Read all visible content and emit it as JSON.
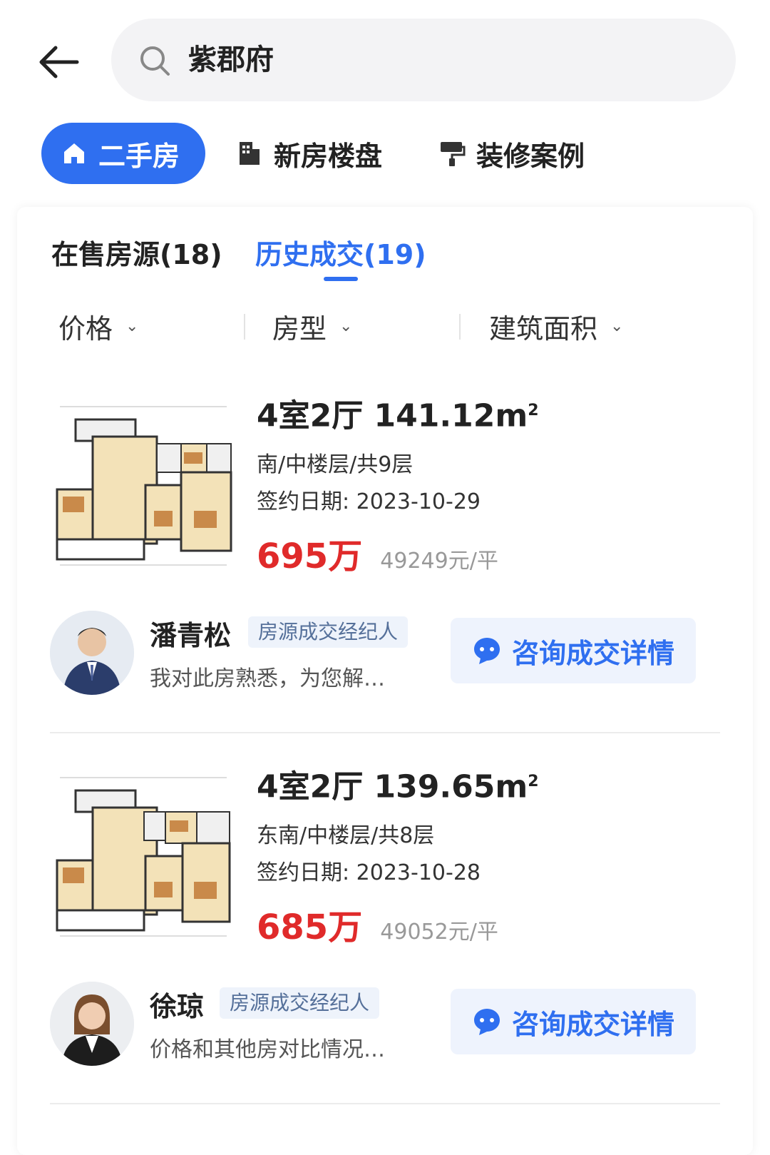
{
  "search": {
    "value": "紫郡府"
  },
  "categories": [
    {
      "label": "二手房",
      "icon": "home-icon",
      "active": true
    },
    {
      "label": "新房楼盘",
      "icon": "building-icon",
      "active": false
    },
    {
      "label": "装修案例",
      "icon": "paint-roller-icon",
      "active": false
    }
  ],
  "tabs": [
    {
      "label": "在售房源(18)",
      "active": false
    },
    {
      "label": "历史成交(19)",
      "active": true
    }
  ],
  "filters": [
    {
      "label": "价格"
    },
    {
      "label": "房型"
    },
    {
      "label": "建筑面积"
    }
  ],
  "listings": [
    {
      "title": "4室2厅 141.12m",
      "area_sup": "2",
      "orientation": "南/中楼层/共9层",
      "sign_date": "签约日期: 2023-10-29",
      "total_price": "695万",
      "unit_price": "49249元/平",
      "agent": {
        "name": "潘青松",
        "role": "房源成交经纪人",
        "desc": "我对此房熟悉，为您解…"
      },
      "consult_label": "咨询成交详情"
    },
    {
      "title": "4室2厅 139.65m",
      "area_sup": "2",
      "orientation": "东南/中楼层/共8层",
      "sign_date": "签约日期: 2023-10-28",
      "total_price": "685万",
      "unit_price": "49052元/平",
      "agent": {
        "name": "徐琼",
        "role": "房源成交经纪人",
        "desc": "价格和其他房对比情况…"
      },
      "consult_label": "咨询成交详情"
    }
  ],
  "colors": {
    "accent": "#2f6ff0",
    "price": "#e02a2a",
    "search_bg": "#f3f3f5"
  }
}
